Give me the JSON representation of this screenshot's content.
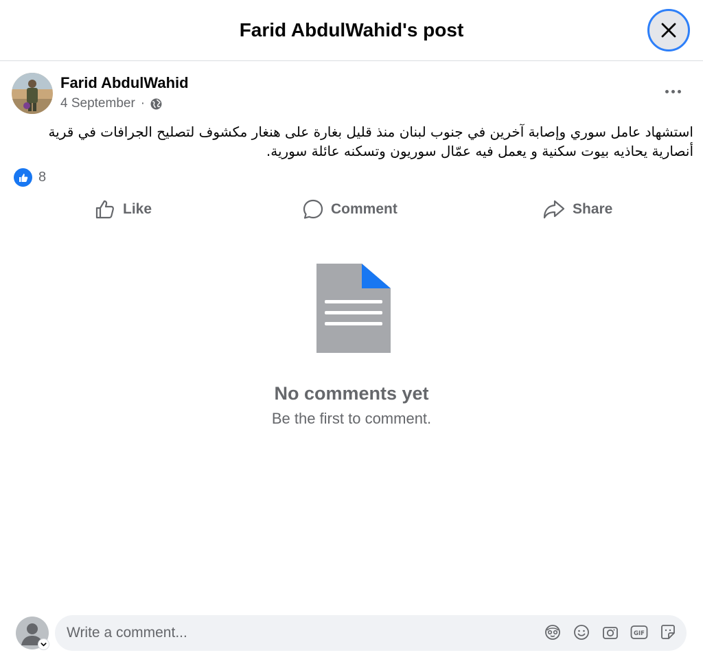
{
  "header": {
    "title": "Farid AbdulWahid's post"
  },
  "post": {
    "author": "Farid AbdulWahid",
    "date": "4 September",
    "separator": "·",
    "text_line1": "استشهاد عامل سوري وإصابة آخرين في جنوب لبنان منذ قليل بغارة على هنغار مكشوف لتصليح الجرافات في قرية",
    "text_line2": "أنصارية يحاذيه بيوت سكنية و يعمل فيه عمّال سوريون وتسكنه عائلة سورية.",
    "reaction_count": "8"
  },
  "actions": {
    "like": "Like",
    "comment": "Comment",
    "share": "Share"
  },
  "comments": {
    "empty_title": "No comments yet",
    "empty_subtitle": "Be the first to comment."
  },
  "composer": {
    "placeholder": "Write a comment..."
  },
  "colors": {
    "accent": "#1877f2",
    "secondary_text": "#65676b",
    "composer_bg": "#f0f2f5"
  },
  "icons": [
    "close-icon",
    "globe-icon",
    "more-icon",
    "like-reaction-icon",
    "like-icon",
    "comment-icon",
    "share-icon",
    "document-icon",
    "avatar-icon",
    "chevron-down-icon",
    "avatar-sticker-icon",
    "emoji-icon",
    "camera-icon",
    "gif-icon",
    "sticker-icon"
  ]
}
